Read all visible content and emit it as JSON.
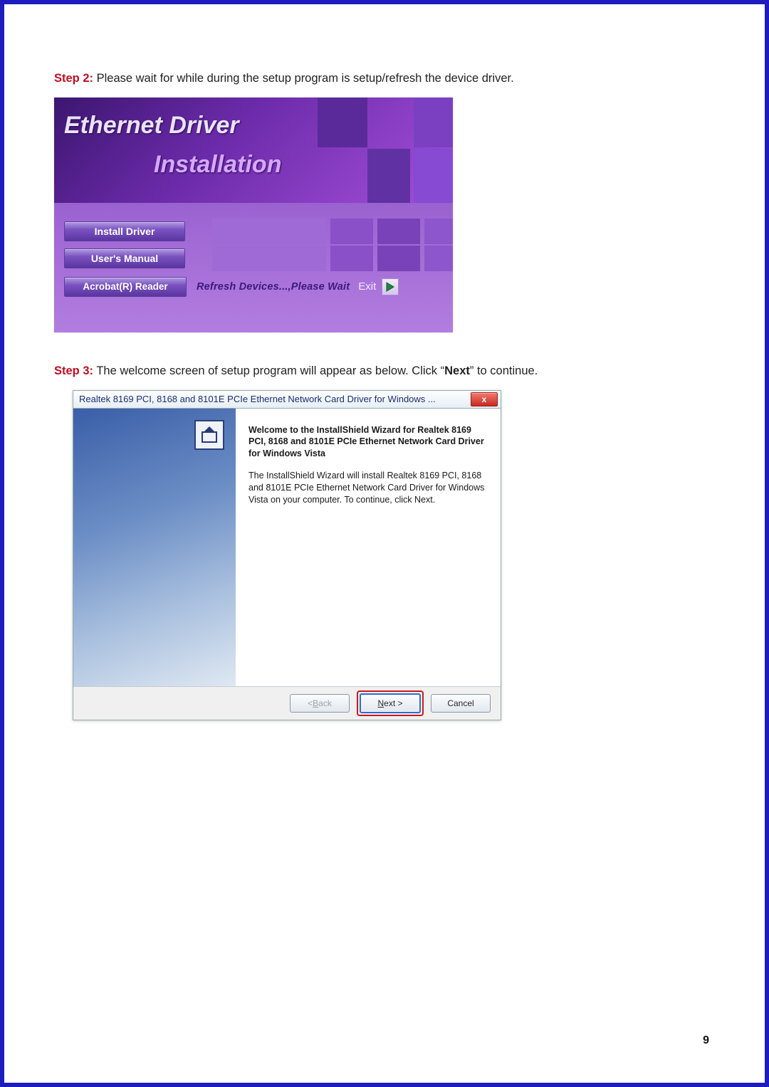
{
  "step2": {
    "label": "Step 2:",
    "text": "Please wait for while during the setup program is setup/refresh the device driver."
  },
  "fig1": {
    "title_line1": "Ethernet Driver",
    "title_line2": "Installation",
    "menu": {
      "install": "Install Driver",
      "manual": "User's Manual",
      "acrobat": "Acrobat(R) Reader"
    },
    "status": "Refresh Devices...,Please Wait",
    "exit": "Exit"
  },
  "step3": {
    "label": "Step 3:",
    "text_a": "The welcome screen of setup program will appear as below. Click “",
    "text_bold": "Next",
    "text_b": "” to continue."
  },
  "fig2": {
    "titlebar": "Realtek 8169 PCI, 8168 and 8101E PCIe Ethernet Network Card Driver for Windows ...",
    "close_glyph": "x",
    "heading": "Welcome to the InstallShield Wizard for Realtek 8169 PCI, 8168 and 8101E PCIe Ethernet Network Card Driver for Windows Vista",
    "description": "The InstallShield Wizard will install Realtek 8169 PCI, 8168 and 8101E PCIe Ethernet Network Card Driver for Windows Vista on your computer.  To continue, click Next.",
    "buttons": {
      "back_prefix": "< ",
      "back_u": "B",
      "back_suffix": "ack",
      "next_u": "N",
      "next_suffix": "ext >",
      "cancel": "Cancel"
    }
  },
  "page_number": "9"
}
